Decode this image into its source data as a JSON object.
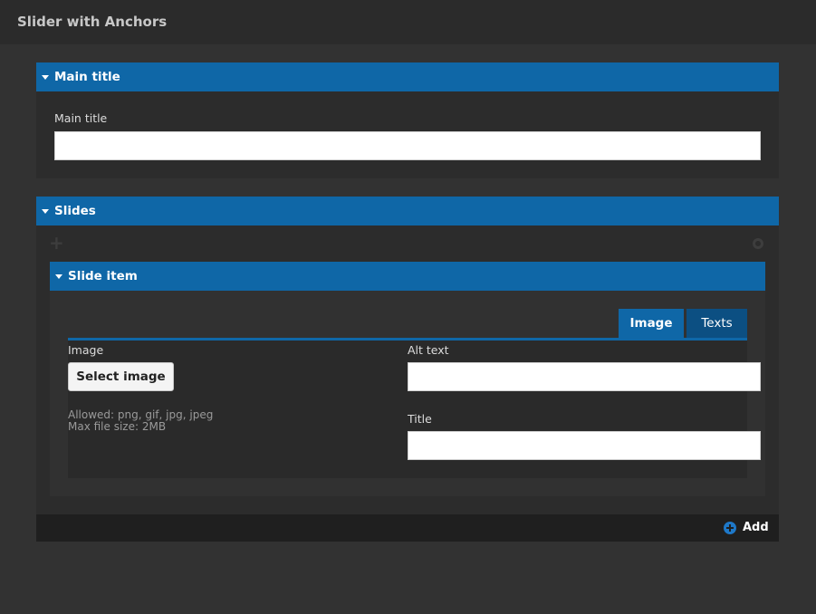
{
  "app": {
    "title": "Slider with Anchors"
  },
  "main_title_section": {
    "header": "Main title",
    "field_label": "Main title",
    "field_value": ""
  },
  "slides_section": {
    "header": "Slides",
    "item": {
      "header": "Slide item",
      "tabs": [
        {
          "label": "Image",
          "active": true
        },
        {
          "label": "Texts",
          "active": false
        }
      ],
      "image": {
        "label": "Image",
        "button_label": "Select image",
        "allowed": "Allowed: png, gif, jpg, jpeg",
        "max_size": "Max file size: 2MB"
      },
      "alt_text": {
        "label": "Alt text",
        "value": ""
      },
      "title": {
        "label": "Title",
        "value": ""
      }
    },
    "add_label": "Add"
  },
  "colors": {
    "accent": "#0f67a7",
    "background": "#323232",
    "panel": "#2c2c2c"
  },
  "icons": [
    "caret-down-icon",
    "plus-icon",
    "gear-icon",
    "add-circle-icon"
  ]
}
